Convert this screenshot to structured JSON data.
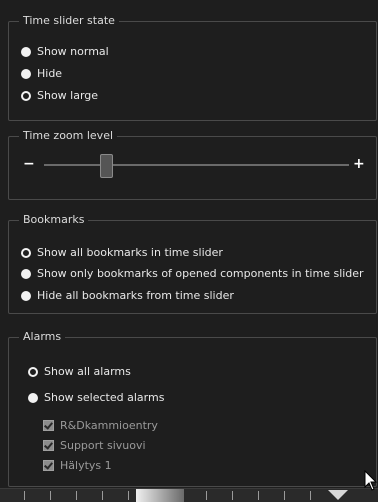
{
  "time_slider_state": {
    "title": "Time slider state",
    "options": [
      {
        "label": "Show normal",
        "selected": true
      },
      {
        "label": "Hide",
        "selected": true
      },
      {
        "label": "Show large",
        "selected": false
      }
    ]
  },
  "time_zoom_level": {
    "title": "Time zoom level",
    "minus": "−",
    "plus": "+",
    "level_fraction": 0.2
  },
  "bookmarks": {
    "title": "Bookmarks",
    "options": [
      {
        "label": "Show all bookmarks in time slider",
        "selected": false
      },
      {
        "label": "Show only bookmarks of opened components in time slider",
        "selected": true
      },
      {
        "label": "Hide all bookmarks from time slider",
        "selected": true
      }
    ]
  },
  "alarms": {
    "title": "Alarms",
    "options": [
      {
        "label": "Show all alarms",
        "selected": false
      },
      {
        "label": "Show selected alarms",
        "selected": true
      }
    ],
    "items": [
      {
        "label": "R&Dkammioentry",
        "checked": true
      },
      {
        "label": "Support sivuovi",
        "checked": true
      },
      {
        "label": "Hälytys 1",
        "checked": true
      }
    ]
  },
  "colors": {
    "background": "#1e1e1e",
    "border": "#4a4a4a",
    "text": "#e6e6e6",
    "disabled_text": "#9a9a9a"
  }
}
